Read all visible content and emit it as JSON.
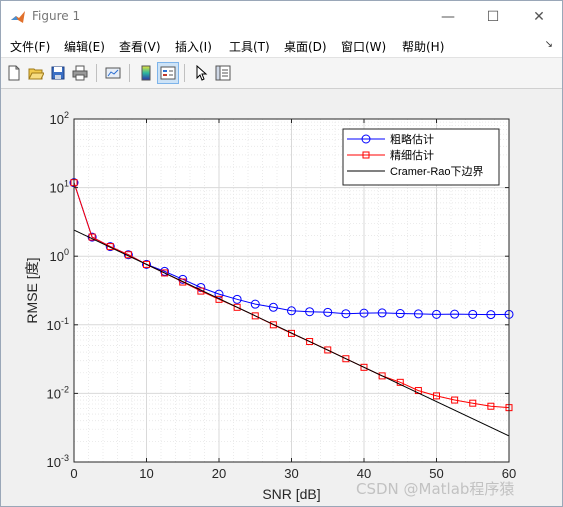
{
  "window": {
    "title": "Figure 1",
    "controls": {
      "minimize": "—",
      "maximize": "☐",
      "close": "✕"
    }
  },
  "menubar": {
    "items": [
      "文件(F)",
      "编辑(E)",
      "查看(V)",
      "插入(I)",
      "工具(T)",
      "桌面(D)",
      "窗口(W)",
      "帮助(H)"
    ],
    "overflow_glyph": "↘"
  },
  "toolbar": {
    "buttons": [
      {
        "icon": "new-figure-icon"
      },
      {
        "icon": "open-file-icon"
      },
      {
        "icon": "save-icon"
      },
      {
        "icon": "print-icon"
      },
      {
        "icon": "link-plot-icon"
      },
      {
        "icon": "insert-colorbar-icon"
      },
      {
        "icon": "insert-legend-icon",
        "active": true
      },
      {
        "icon": "edit-plot-arrow-icon"
      },
      {
        "icon": "property-inspector-icon"
      }
    ]
  },
  "watermark": "CSDN @Matlab程序猿",
  "chart_data": {
    "type": "line",
    "xlabel": "SNR [dB]",
    "ylabel": "RMSE [度]",
    "xlim": [
      0,
      60
    ],
    "ylim": [
      0.001,
      100
    ],
    "yscale": "log",
    "xticks": [
      0,
      10,
      20,
      30,
      40,
      50,
      60
    ],
    "yticks": [
      {
        "value": 0.001,
        "base": "10",
        "exp": "-3"
      },
      {
        "value": 0.01,
        "base": "10",
        "exp": "-2"
      },
      {
        "value": 0.1,
        "base": "10",
        "exp": "-1"
      },
      {
        "value": 1,
        "base": "10",
        "exp": "0"
      },
      {
        "value": 10,
        "base": "10",
        "exp": "1"
      },
      {
        "value": 100,
        "base": "10",
        "exp": "2"
      }
    ],
    "grid": true,
    "minor_grid": true,
    "legend_position": "top-right",
    "series": [
      {
        "name": "粗略估计",
        "color": "#0000ff",
        "marker": "circle",
        "x": [
          0,
          2.5,
          5,
          7.5,
          10,
          12.5,
          15,
          17.5,
          20,
          22.5,
          25,
          27.5,
          30,
          32.5,
          35,
          37.5,
          40,
          42.5,
          45,
          47.5,
          50,
          52.5,
          55,
          57.5,
          60
        ],
        "y": [
          11.8,
          1.9,
          1.38,
          1.05,
          0.76,
          0.6,
          0.46,
          0.35,
          0.28,
          0.235,
          0.2,
          0.18,
          0.16,
          0.155,
          0.152,
          0.145,
          0.148,
          0.149,
          0.146,
          0.144,
          0.142,
          0.143,
          0.142,
          0.141,
          0.142
        ]
      },
      {
        "name": "精细估计",
        "color": "#ff0000",
        "marker": "square",
        "x": [
          0,
          2.5,
          5,
          7.5,
          10,
          12.5,
          15,
          17.5,
          20,
          22.5,
          25,
          27.5,
          30,
          32.5,
          35,
          37.5,
          40,
          42.5,
          45,
          47.5,
          50,
          52.5,
          55,
          57.5,
          60
        ],
        "y": [
          11.8,
          1.9,
          1.38,
          1.05,
          0.76,
          0.57,
          0.42,
          0.31,
          0.235,
          0.18,
          0.135,
          0.1,
          0.075,
          0.057,
          0.043,
          0.032,
          0.024,
          0.018,
          0.0145,
          0.011,
          0.0092,
          0.008,
          0.0072,
          0.0065,
          0.0062
        ]
      },
      {
        "name": "Cramer-Rao下边界",
        "color": "#000000",
        "marker": "none",
        "x": [
          0,
          60
        ],
        "y": [
          2.4,
          0.0024
        ]
      }
    ]
  }
}
